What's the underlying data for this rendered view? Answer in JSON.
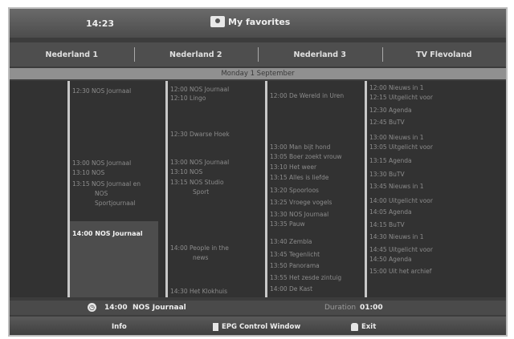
{
  "header": {
    "time": "14:23",
    "title": "My favorites"
  },
  "tabs": [
    "Nederland 1",
    "Nederland 2",
    "Nederland 3",
    "TV Flevoland"
  ],
  "date": "Monday 1 September",
  "channels": [
    {
      "programs": [
        {
          "time": "12:30",
          "title": "NOS Journaal"
        },
        {
          "time": "13:00",
          "title": "NOS Journaal"
        },
        {
          "time": "13:10",
          "title": "NOS"
        },
        {
          "time": "13:15",
          "title": "NOS Journaal en"
        },
        {
          "time": "",
          "title": "NOS"
        },
        {
          "time": "",
          "title": "Sportjournaal"
        },
        {
          "time": "14:00",
          "title": "NOS Journaal",
          "selected": true
        }
      ]
    },
    {
      "programs": [
        {
          "time": "12:00",
          "title": "NOS Journaal"
        },
        {
          "time": "12:10",
          "title": "Lingo"
        },
        {
          "time": "12:30",
          "title": "Dwarse Hoek"
        },
        {
          "time": "13:00",
          "title": "NOS Journaal"
        },
        {
          "time": "13:10",
          "title": "NOS"
        },
        {
          "time": "13:15",
          "title": "NOS Studio"
        },
        {
          "time": "",
          "title": "Sport"
        },
        {
          "time": "14:00",
          "title": "People in the"
        },
        {
          "time": "",
          "title": "news"
        },
        {
          "time": "14:30",
          "title": "Het Klokhuis"
        }
      ]
    },
    {
      "programs": [
        {
          "time": "12:00",
          "title": "De Wereld in Uren"
        },
        {
          "time": "13:00",
          "title": "Man bijt hond"
        },
        {
          "time": "13:05",
          "title": "Boer zoekt vrouw"
        },
        {
          "time": "13:10",
          "title": "Het weer"
        },
        {
          "time": "13:15",
          "title": "Alles is liefde"
        },
        {
          "time": "13:20",
          "title": "Spoorloos"
        },
        {
          "time": "13:25",
          "title": "Vroege vogels"
        },
        {
          "time": "13:30",
          "title": "NOS Journaal"
        },
        {
          "time": "13:35",
          "title": "Pauw"
        },
        {
          "time": "13:40",
          "title": "Zembla"
        },
        {
          "time": "13:45",
          "title": "Tegenlicht"
        },
        {
          "time": "13:50",
          "title": "Panorama"
        },
        {
          "time": "13:55",
          "title": "Het zesde zintuig"
        },
        {
          "time": "14:00",
          "title": "De Kast"
        }
      ]
    },
    {
      "programs": [
        {
          "time": "12:00",
          "title": "Nieuws in 1"
        },
        {
          "time": "12:15",
          "title": "Uitgelicht voor"
        },
        {
          "time": "12:30",
          "title": "Agenda"
        },
        {
          "time": "12:45",
          "title": "BuTV"
        },
        {
          "time": "13:00",
          "title": "Nieuws in 1"
        },
        {
          "time": "13:05",
          "title": "Uitgelicht voor"
        },
        {
          "time": "13:15",
          "title": "Agenda"
        },
        {
          "time": "13:30",
          "title": "BuTV"
        },
        {
          "time": "13:45",
          "title": "Nieuws in 1"
        },
        {
          "time": "14:00",
          "title": "Uitgelicht voor"
        },
        {
          "time": "14:05",
          "title": "Agenda"
        },
        {
          "time": "14:15",
          "title": "BuTV"
        },
        {
          "time": "14:30",
          "title": "Nieuws in 1"
        },
        {
          "time": "14:45",
          "title": "Uitgelicht voor"
        },
        {
          "time": "14:50",
          "title": "Agenda"
        },
        {
          "time": "15:00",
          "title": "Uit het archief"
        }
      ]
    }
  ],
  "info": {
    "time": "14:00",
    "program": "NOS Journaal",
    "duration_label": "Duration",
    "duration_value": "01:00"
  },
  "footer": {
    "info_label": "Info",
    "epg_label": "EPG Control Window",
    "exit_label": "Exit"
  }
}
